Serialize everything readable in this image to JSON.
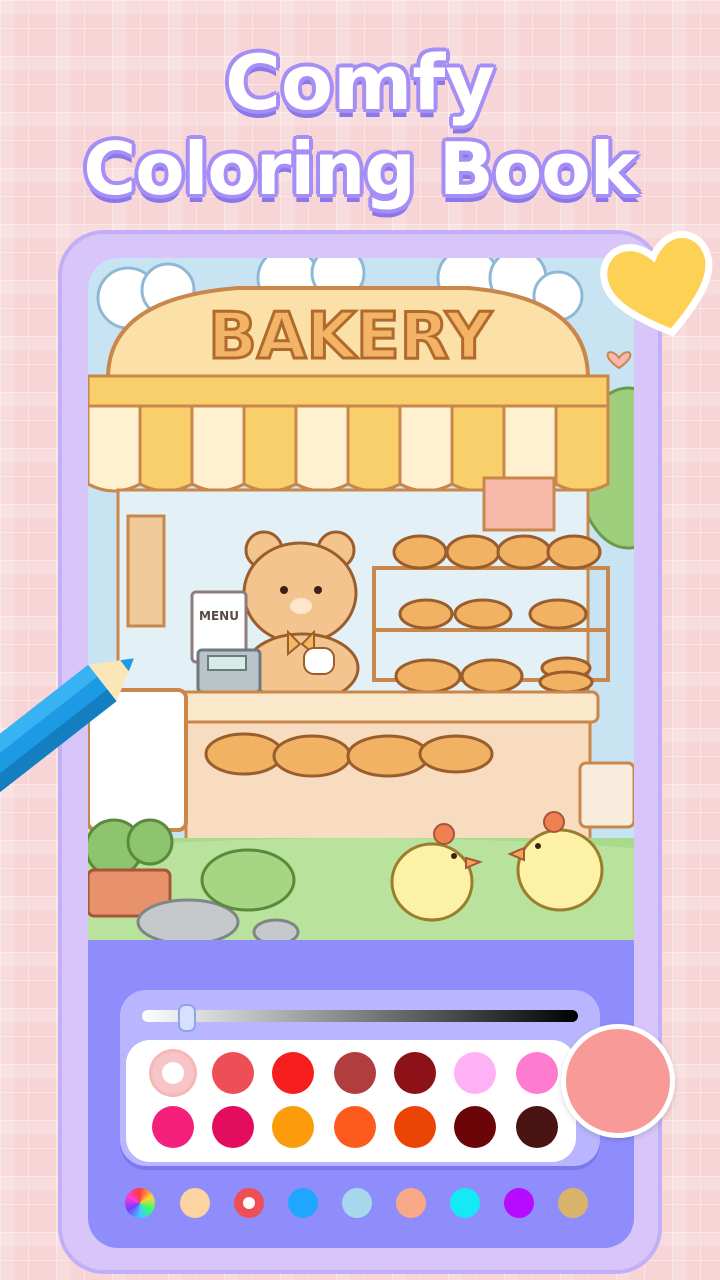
{
  "title": {
    "line1": "Comfy",
    "line2": "Coloring Book"
  },
  "artwork": {
    "sign": "BAKERY",
    "menu": "MENU"
  },
  "colors": {
    "title_outline": "#a58ef5",
    "phone_frame": "#d8c6fb",
    "screen_bg": "#8f8dfc",
    "current_color": "#f79a98"
  },
  "slider": {
    "position": 0.1
  },
  "palette": {
    "row1": [
      "#f7c5c8",
      "#ee4e55",
      "#f51d1d",
      "#b13d3e",
      "#8c1217",
      "#ffb1f6",
      "#ff7bcf"
    ],
    "row2": [
      "#f51f7c",
      "#e20e5d",
      "#fd9c0a",
      "#fd5b1e",
      "#ec4405",
      "#6a0607",
      "#4a1413"
    ],
    "selected": "#f7c5c8"
  },
  "color_groups": [
    "rainbow",
    "#fbd4a2",
    "#ee4e55",
    "#1fa6ff",
    "#a7d8ee",
    "#f9a988",
    "#15e9f3",
    "#b60bff",
    "#dab46a"
  ],
  "decorations": {
    "heart_icon": "heart-icon",
    "pencil_icon": "pencil-icon"
  }
}
